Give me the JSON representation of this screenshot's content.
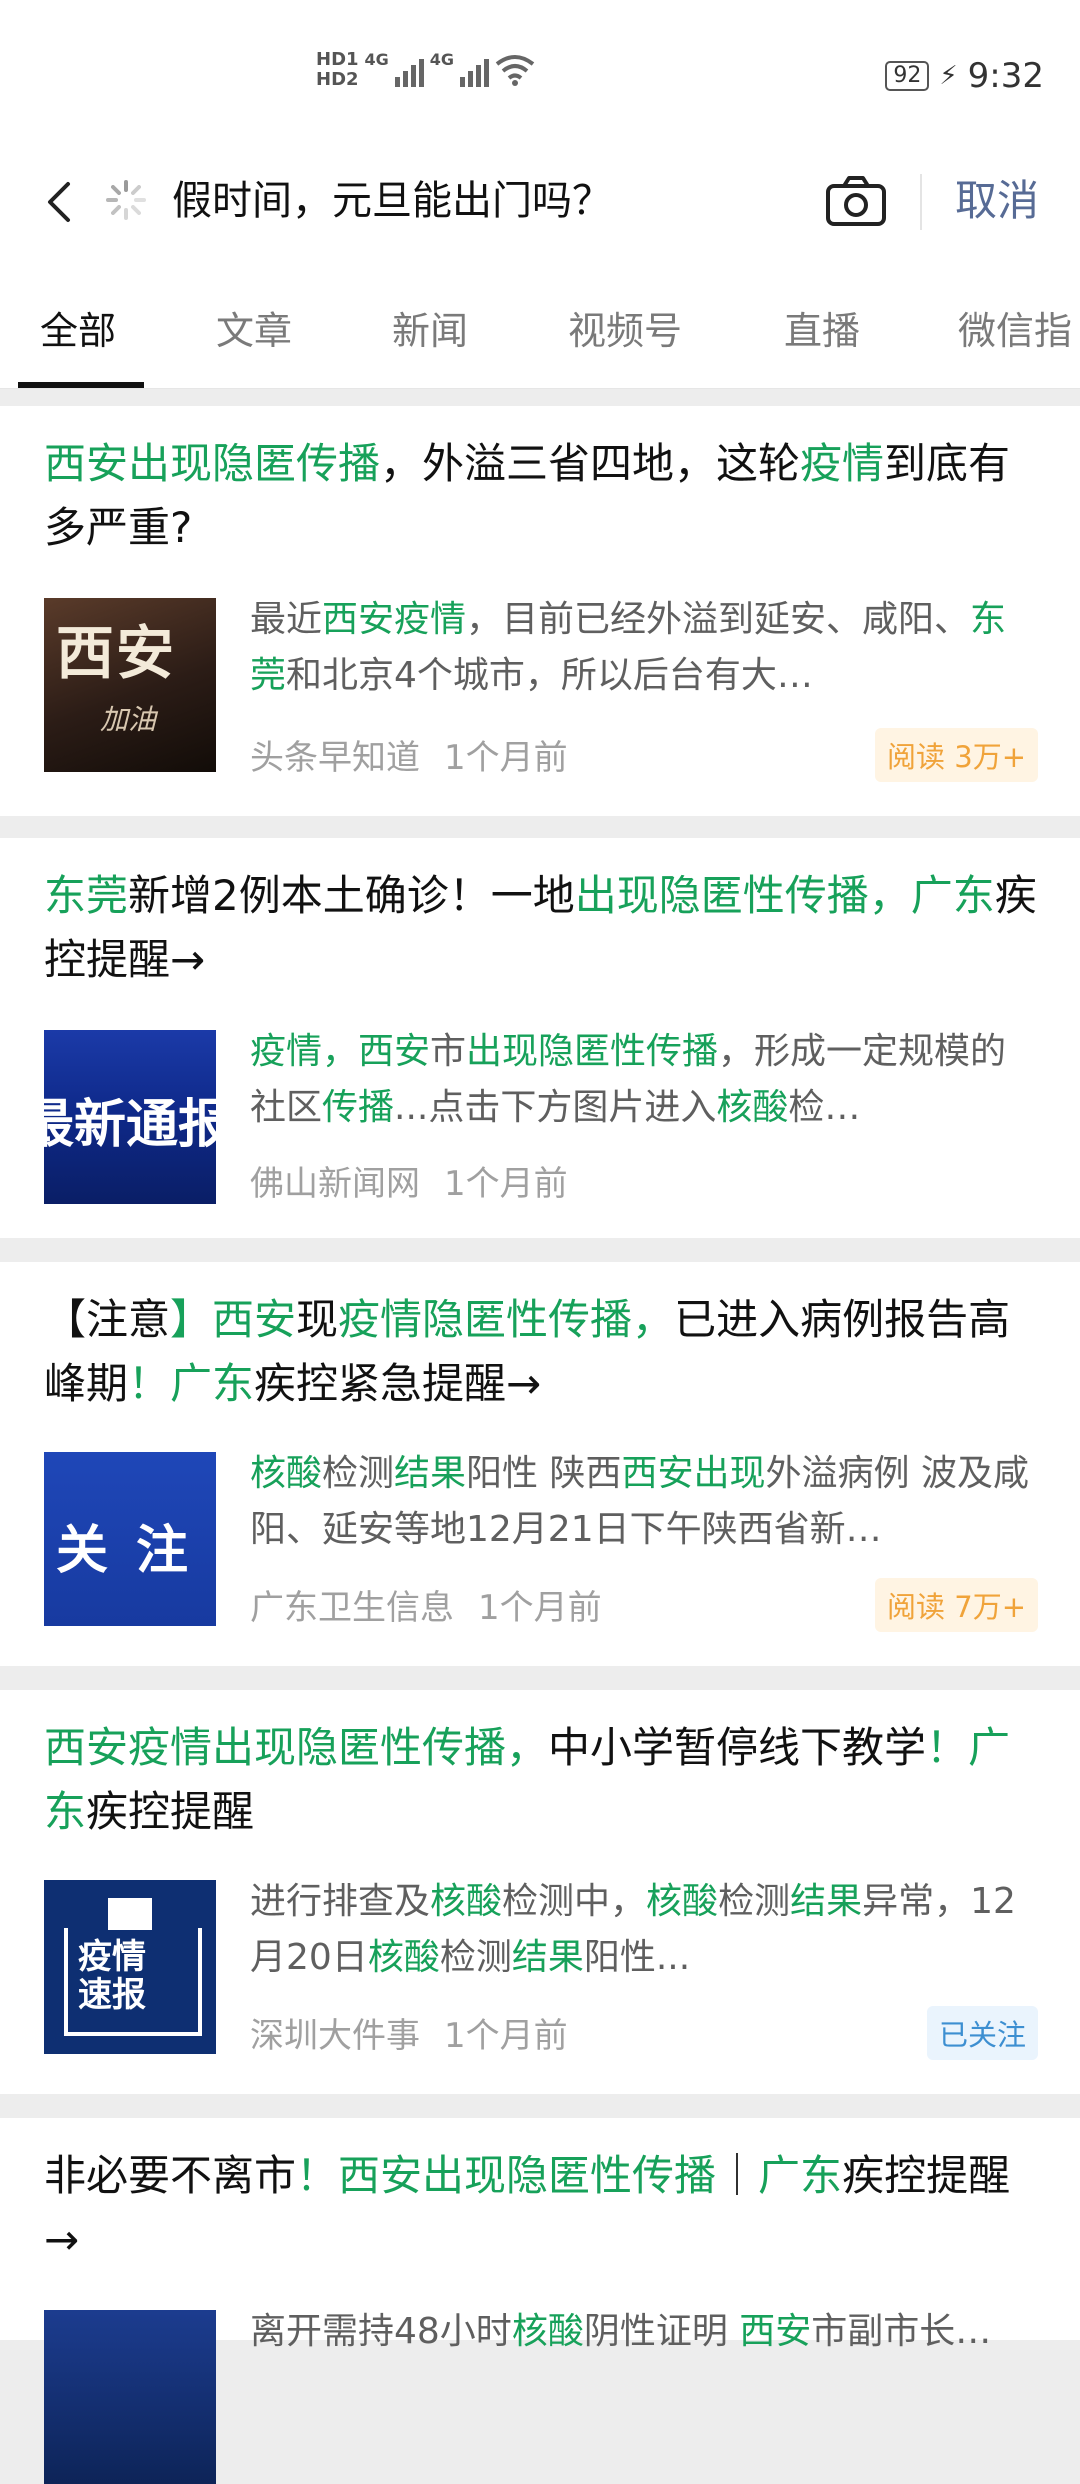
{
  "status_bar": {
    "left_icons": [
      "HD1",
      "HD2",
      "4G",
      "4G"
    ],
    "battery": "92",
    "time": "9:32"
  },
  "search": {
    "query": "假时间，元旦能出门吗？",
    "cancel_label": "取消"
  },
  "tabs": [
    {
      "label": "全部"
    },
    {
      "label": "文章"
    },
    {
      "label": "新闻"
    },
    {
      "label": "视频号"
    },
    {
      "label": "直播"
    },
    {
      "label": "微信指"
    }
  ],
  "results": [
    {
      "title_parts": [
        {
          "t": "西安出现隐匿传播",
          "hl": true
        },
        {
          "t": "，外溢三省四地，这轮",
          "hl": false
        },
        {
          "t": "疫情",
          "hl": true
        },
        {
          "t": "到底有多严重?",
          "hl": false
        }
      ],
      "thumb_text_main": "西安",
      "thumb_text_sub": "加油",
      "snippet_parts": [
        {
          "t": "最近",
          "hl": false
        },
        {
          "t": "西安疫情",
          "hl": true
        },
        {
          "t": "，目前已经外溢到延安、咸阳、",
          "hl": false
        },
        {
          "t": "东莞",
          "hl": true
        },
        {
          "t": "和北京4个城市，所以后台有大…",
          "hl": false
        }
      ],
      "source": "头条早知道",
      "time": "1个月前",
      "badge": "阅读 3万+",
      "badge_type": "read"
    },
    {
      "title_parts": [
        {
          "t": "东莞",
          "hl": true
        },
        {
          "t": "新增2例本土确诊！一地",
          "hl": false
        },
        {
          "t": "出现隐匿性传播，广东",
          "hl": true
        },
        {
          "t": "疾控提醒→",
          "hl": false
        }
      ],
      "thumb_text_main": "最新通报",
      "snippet_parts": [
        {
          "t": "疫情，西安",
          "hl": true
        },
        {
          "t": "市",
          "hl": false
        },
        {
          "t": "出现隐匿性传播",
          "hl": true
        },
        {
          "t": "，形成一定规模的社区",
          "hl": false
        },
        {
          "t": "传播",
          "hl": true
        },
        {
          "t": "...点击下方图片进入",
          "hl": false
        },
        {
          "t": "核酸",
          "hl": true
        },
        {
          "t": "检…",
          "hl": false
        }
      ],
      "source": "佛山新闻网",
      "time": "1个月前",
      "badge": "",
      "badge_type": ""
    },
    {
      "title_parts": [
        {
          "t": "【注意",
          "hl": false
        },
        {
          "t": "】西安",
          "hl": true
        },
        {
          "t": "现",
          "hl": false
        },
        {
          "t": "疫情隐匿性传播，",
          "hl": true
        },
        {
          "t": "已进入病例报告高峰期",
          "hl": false
        },
        {
          "t": "！广东",
          "hl": true
        },
        {
          "t": "疾控紧急提醒→",
          "hl": false
        }
      ],
      "thumb_text_main": "关注",
      "snippet_parts": [
        {
          "t": "核酸",
          "hl": true
        },
        {
          "t": "检测",
          "hl": false
        },
        {
          "t": "结果",
          "hl": true
        },
        {
          "t": "阳性 陕西",
          "hl": false
        },
        {
          "t": "西安出现",
          "hl": true
        },
        {
          "t": "外溢病例 波及咸阳、延安等地12月21日下午陕西省新…",
          "hl": false
        }
      ],
      "source": "广东卫生信息",
      "time": "1个月前",
      "badge": "阅读 7万+",
      "badge_type": "read"
    },
    {
      "title_parts": [
        {
          "t": "西安疫情出现隐匿性传播，",
          "hl": true
        },
        {
          "t": "中小学暂停线下教学",
          "hl": false
        },
        {
          "t": "！广东",
          "hl": true
        },
        {
          "t": "疾控提醒",
          "hl": false
        }
      ],
      "thumb_text_main": "疫情速报",
      "snippet_parts": [
        {
          "t": "进行排查及",
          "hl": false
        },
        {
          "t": "核酸",
          "hl": true
        },
        {
          "t": "检测中，",
          "hl": false
        },
        {
          "t": "核酸",
          "hl": true
        },
        {
          "t": "检测",
          "hl": false
        },
        {
          "t": "结果",
          "hl": true
        },
        {
          "t": "异常，12月20日",
          "hl": false
        },
        {
          "t": "核酸",
          "hl": true
        },
        {
          "t": "检测",
          "hl": false
        },
        {
          "t": "结果",
          "hl": true
        },
        {
          "t": "阳性...",
          "hl": false
        }
      ],
      "source": "深圳大件事",
      "time": "1个月前",
      "badge": "已关注",
      "badge_type": "follow"
    },
    {
      "title_parts": [
        {
          "t": "非必要不离市",
          "hl": false
        },
        {
          "t": "！西安出现隐匿性传播",
          "hl": true
        },
        {
          "t": "｜",
          "hl": false
        },
        {
          "t": "广东",
          "hl": true
        },
        {
          "t": "疾控提醒→",
          "hl": false
        }
      ],
      "thumb_text_main": "",
      "snippet_parts": [
        {
          "t": "离开需持48小时",
          "hl": false
        },
        {
          "t": "核酸",
          "hl": true
        },
        {
          "t": "阴性证明 ",
          "hl": false
        },
        {
          "t": "西安",
          "hl": true
        },
        {
          "t": "市副市长…",
          "hl": false
        }
      ],
      "source": "",
      "time": "",
      "badge": "",
      "badge_type": ""
    }
  ]
}
